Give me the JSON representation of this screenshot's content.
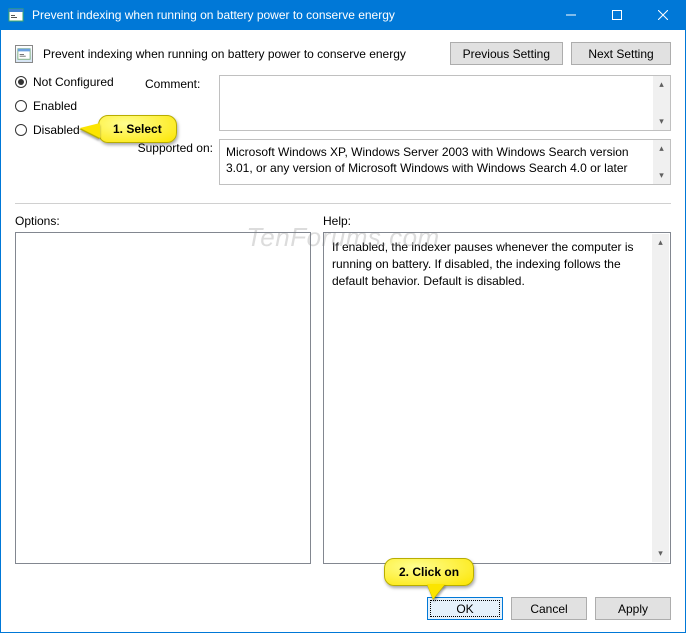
{
  "window": {
    "title": "Prevent indexing when running on battery power to conserve energy"
  },
  "header": {
    "title": "Prevent indexing when running on battery power to conserve energy",
    "prev_btn": "Previous Setting",
    "next_btn": "Next Setting"
  },
  "state": {
    "not_configured": "Not Configured",
    "enabled": "Enabled",
    "disabled": "Disabled",
    "selected": "not_configured"
  },
  "fields": {
    "comment_label": "Comment:",
    "supported_label": "Supported on:",
    "supported_text": "Microsoft Windows XP, Windows Server 2003 with Windows Search version 3.01, or any version of Microsoft Windows with Windows Search 4.0 or later"
  },
  "panels": {
    "options_label": "Options:",
    "help_label": "Help:",
    "help_text": "If enabled, the indexer pauses whenever the computer is running on battery. If disabled, the indexing follows the default behavior. Default is disabled."
  },
  "buttons": {
    "ok": "OK",
    "cancel": "Cancel",
    "apply": "Apply"
  },
  "callouts": {
    "c1": "1. Select",
    "c2": "2. Click on"
  },
  "watermark": "TenForums.com"
}
